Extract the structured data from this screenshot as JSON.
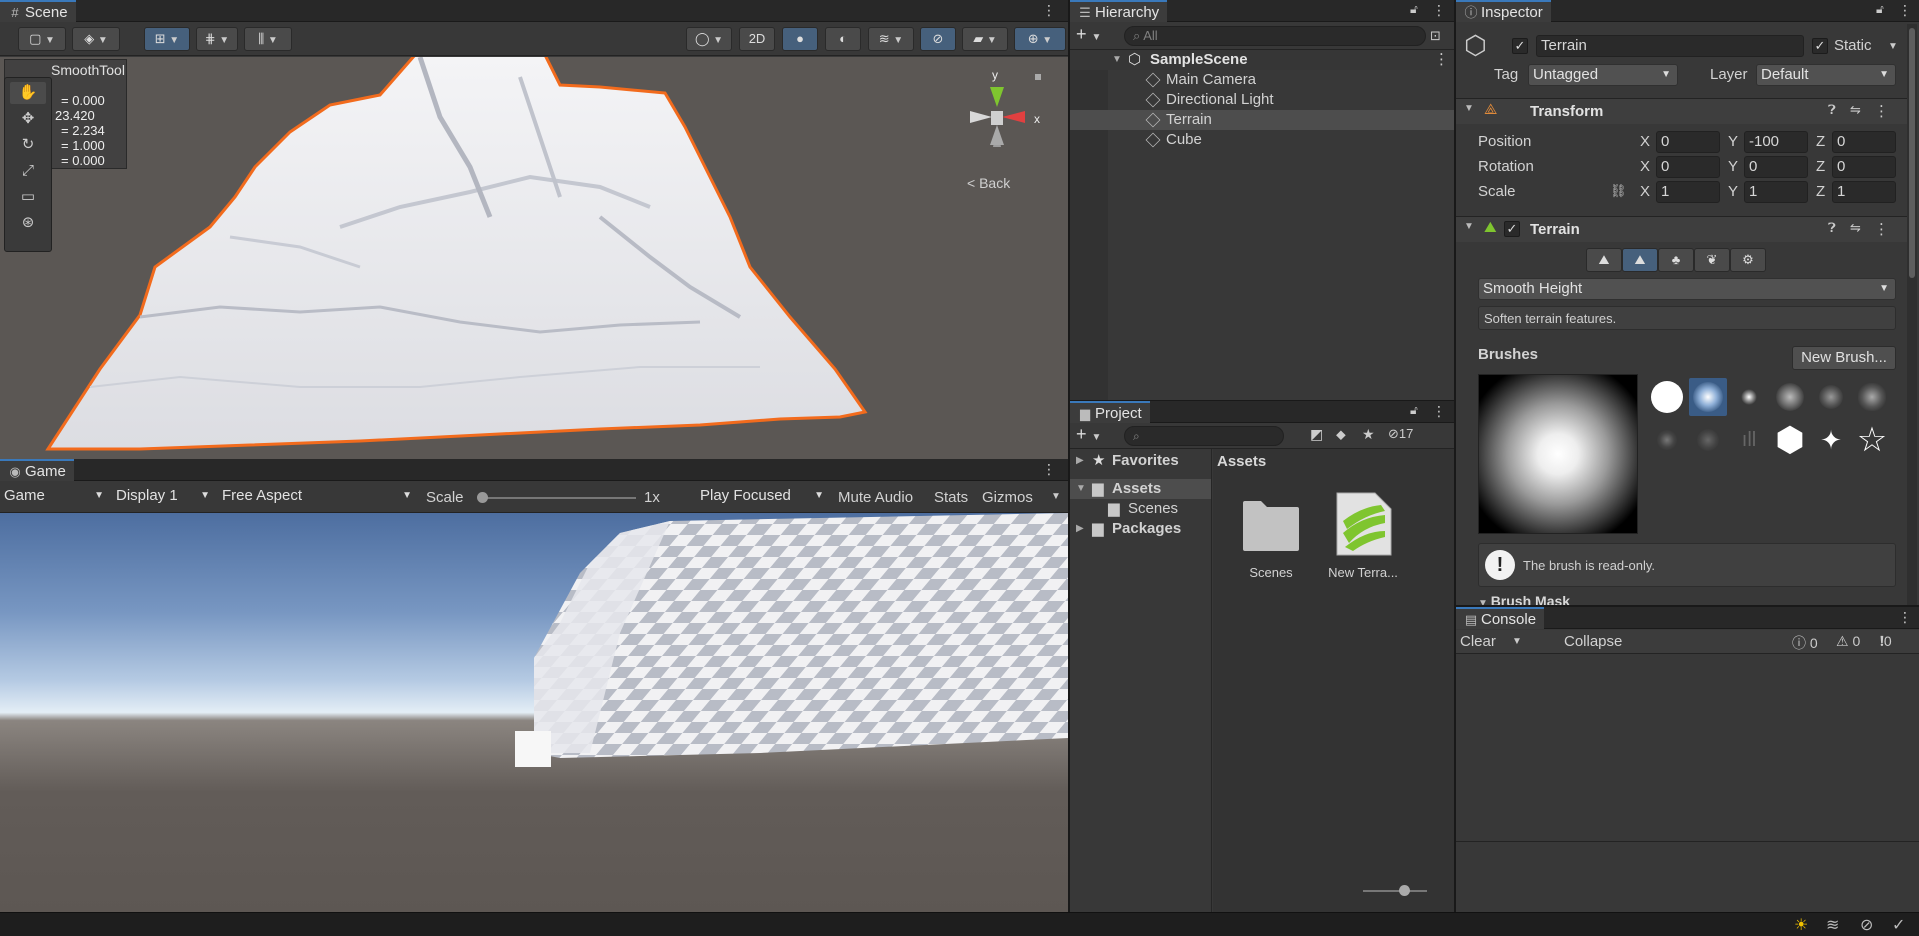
{
  "scene": {
    "tab_label": "Scene",
    "tool_overlay_title": "SmoothTool",
    "overlay_values": [
      "= 0.000",
      "23.420",
      "= 2.234",
      "= 1.000",
      "= 0.000"
    ],
    "gizmo": {
      "y": "y",
      "x": "x",
      "back": "< Back"
    },
    "toolbar_2d": "2D"
  },
  "game": {
    "tab_label": "Game",
    "display_mode": "Game",
    "display": "Display 1",
    "aspect": "Free Aspect",
    "scale_label": "Scale",
    "scale_value": "1x",
    "play_mode": "Play Focused",
    "mute": "Mute Audio",
    "stats": "Stats",
    "gizmos": "Gizmos"
  },
  "hierarchy": {
    "tab_label": "Hierarchy",
    "search_placeholder": "All",
    "scene_name": "SampleScene",
    "items": [
      {
        "label": "Main Camera"
      },
      {
        "label": "Directional Light"
      },
      {
        "label": "Terrain",
        "selected": true
      },
      {
        "label": "Cube"
      }
    ]
  },
  "project": {
    "tab_label": "Project",
    "hidden_count": "17",
    "tree": {
      "favorites": "Favorites",
      "assets": "Assets",
      "scenes": "Scenes",
      "packages": "Packages"
    },
    "breadcrumb": "Assets",
    "assets": [
      {
        "label": "Scenes",
        "icon": "folder-icon"
      },
      {
        "label": "New Terra...",
        "icon": "terrain-asset-icon"
      }
    ]
  },
  "inspector": {
    "tab_label": "Inspector",
    "object_name": "Terrain",
    "active": true,
    "static_label": "Static",
    "static": true,
    "tag_label": "Tag",
    "tag_value": "Untagged",
    "layer_label": "Layer",
    "layer_value": "Default",
    "transform": {
      "title": "Transform",
      "position_label": "Position",
      "rotation_label": "Rotation",
      "scale_label": "Scale",
      "position": {
        "x": "0",
        "y": "-100",
        "z": "0"
      },
      "rotation": {
        "x": "0",
        "y": "0",
        "z": "0"
      },
      "scale": {
        "x": "1",
        "y": "1",
        "z": "1"
      },
      "axis": {
        "x": "X",
        "y": "Y",
        "z": "Z"
      }
    },
    "terrain": {
      "title": "Terrain",
      "tool_dropdown": "Smooth Height",
      "tool_description": "Soften terrain features.",
      "brushes_label": "Brushes",
      "new_brush_button": "New Brush...",
      "readonly_message": "The brush is read-only.",
      "brush_mask_label": "Brush Mask"
    }
  },
  "console": {
    "tab_label": "Console",
    "clear": "Clear",
    "collapse": "Collapse",
    "info_count": "0",
    "warn_count": "0",
    "error_count": "0"
  },
  "colors": {
    "accent": "#3a79bb",
    "selection_outline": "#f26b1d",
    "selected_row": "#4d4d4d"
  }
}
